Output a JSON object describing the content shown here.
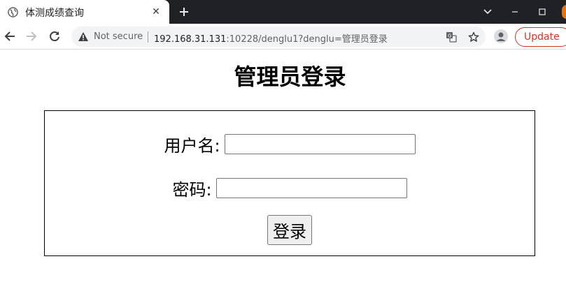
{
  "browser": {
    "tab": {
      "title": "体测成绩查询",
      "close_glyph": "✕",
      "favicon": "globe-icon"
    },
    "new_tab_glyph": "+",
    "window_controls": [
      "chevron-down-icon",
      "minimize-icon",
      "maximize-icon",
      "close-icon"
    ],
    "omnibox": {
      "security_label": "Not secure",
      "url_host": "192.168.31.131",
      "url_rest": ":10228/denglu1?denglu=管理员登录"
    },
    "update_label": "Update",
    "accent_warning": "#d93025",
    "tabstrip_color": "#202124"
  },
  "page": {
    "title": "管理员登录",
    "username_label": "用户名:",
    "username_value": "",
    "password_label": "密码:",
    "password_value": "",
    "login_button": "登录"
  }
}
